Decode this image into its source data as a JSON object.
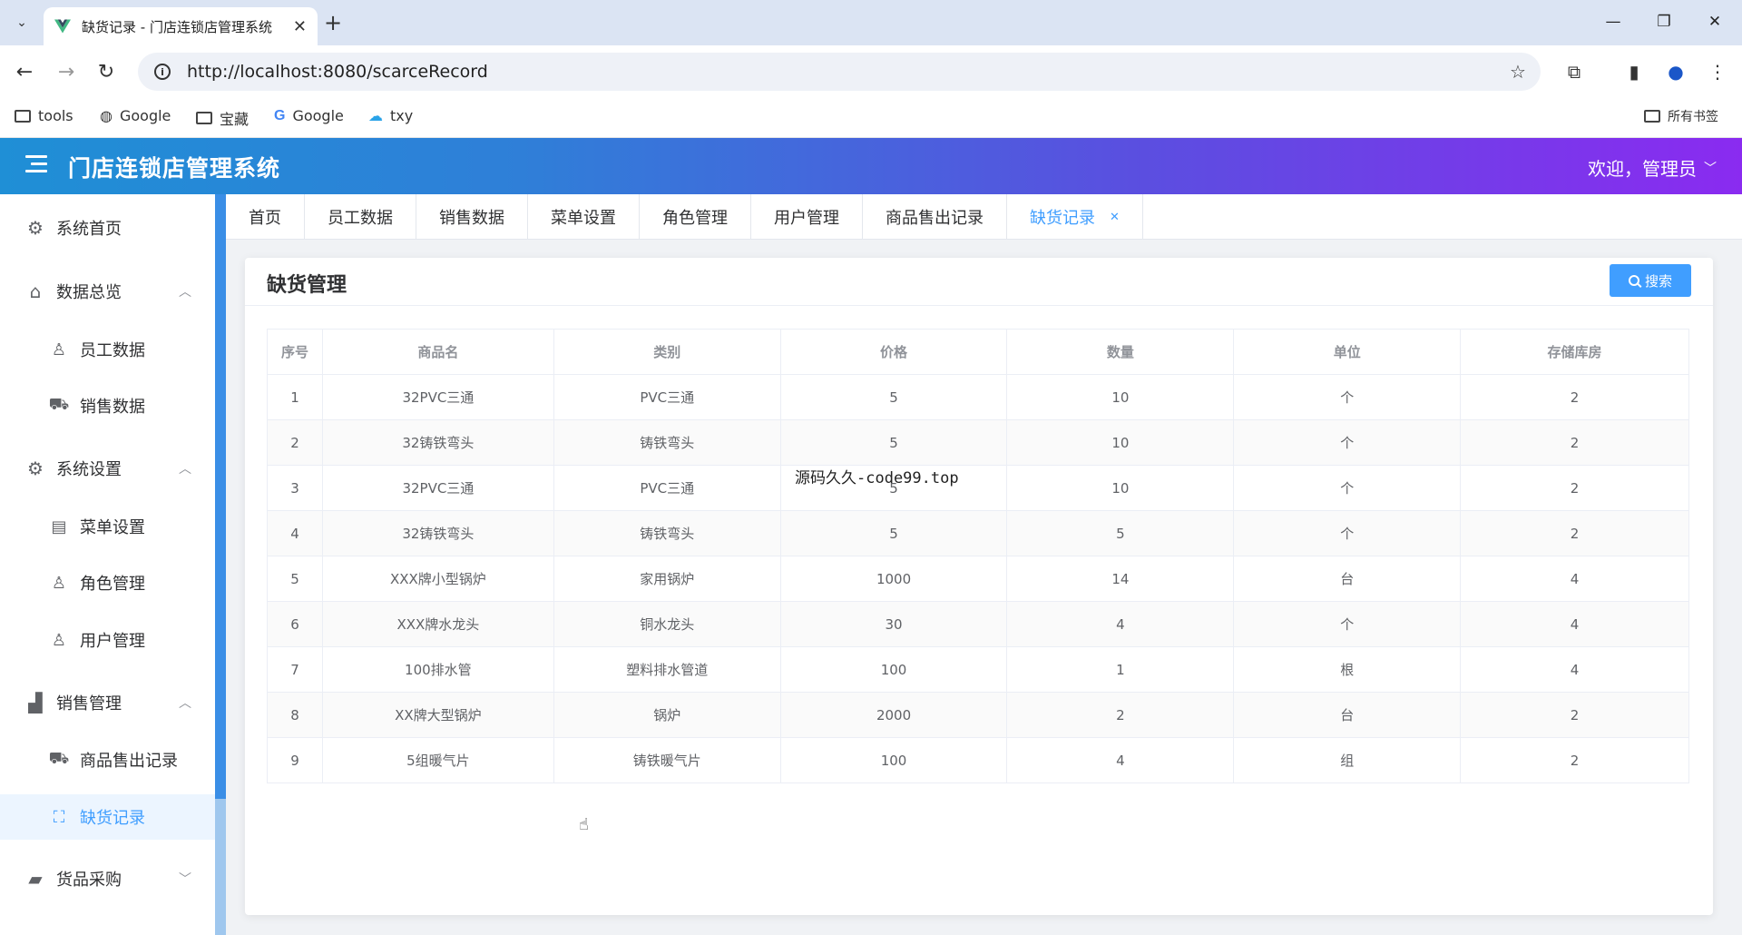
{
  "browser": {
    "tab_title": "缺货记录 - 门店连锁店管理系统",
    "url": "http://localhost:8080/scarceRecord",
    "bookmarks": [
      {
        "label": "tools",
        "icon": "folder-icon"
      },
      {
        "label": "Google",
        "icon": "globe-icon"
      },
      {
        "label": "宝藏",
        "icon": "folder-icon"
      },
      {
        "label": "Google",
        "icon": "google-icon"
      },
      {
        "label": "txy",
        "icon": "cloud-icon"
      }
    ],
    "all_bookmarks": "所有书签"
  },
  "header": {
    "title": "门店连锁店管理系统",
    "welcome": "欢迎，管理员"
  },
  "sidebar": {
    "items": [
      {
        "label": "系统首页",
        "icon": "gear-icon"
      },
      {
        "label": "数据总览",
        "icon": "home-icon"
      },
      {
        "label": "员工数据",
        "icon": "user-icon"
      },
      {
        "label": "销售数据",
        "icon": "truck-icon"
      },
      {
        "label": "系统设置",
        "icon": "gear-icon"
      },
      {
        "label": "菜单设置",
        "icon": "document-icon"
      },
      {
        "label": "角色管理",
        "icon": "user-icon"
      },
      {
        "label": "用户管理",
        "icon": "user-icon"
      },
      {
        "label": "销售管理",
        "icon": "chart-icon"
      },
      {
        "label": "商品售出记录",
        "icon": "truck-icon"
      },
      {
        "label": "缺货记录",
        "icon": "bag-icon"
      },
      {
        "label": "货品采购",
        "icon": "lock-icon"
      }
    ]
  },
  "tags": [
    "首页",
    "员工数据",
    "销售数据",
    "菜单设置",
    "角色管理",
    "用户管理",
    "商品售出记录",
    "缺货记录"
  ],
  "card": {
    "title": "缺货管理",
    "search_label": "搜索"
  },
  "table": {
    "columns": [
      "序号",
      "商品名",
      "类别",
      "价格",
      "数量",
      "单位",
      "存储库房"
    ],
    "rows": [
      [
        "1",
        "32PVC三通",
        "PVC三通",
        "5",
        "10",
        "个",
        "2"
      ],
      [
        "2",
        "32铸铁弯头",
        "铸铁弯头",
        "5",
        "10",
        "个",
        "2"
      ],
      [
        "3",
        "32PVC三通",
        "PVC三通",
        "5",
        "10",
        "个",
        "2"
      ],
      [
        "4",
        "32铸铁弯头",
        "铸铁弯头",
        "5",
        "5",
        "个",
        "2"
      ],
      [
        "5",
        "XXX牌小型锅炉",
        "家用锅炉",
        "1000",
        "14",
        "台",
        "4"
      ],
      [
        "6",
        "XXX牌水龙头",
        "铜水龙头",
        "30",
        "4",
        "个",
        "4"
      ],
      [
        "7",
        "100排水管",
        "塑料排水管道",
        "100",
        "1",
        "根",
        "4"
      ],
      [
        "8",
        "XX牌大型锅炉",
        "锅炉",
        "2000",
        "2",
        "台",
        "2"
      ],
      [
        "9",
        "5组暖气片",
        "铸铁暖气片",
        "100",
        "4",
        "组",
        "2"
      ]
    ]
  },
  "overlay_text": "源码久久-code99.top",
  "colors": {
    "accent": "#409eff",
    "header_start": "#1f8fd6",
    "header_end": "#8a2bf0"
  }
}
